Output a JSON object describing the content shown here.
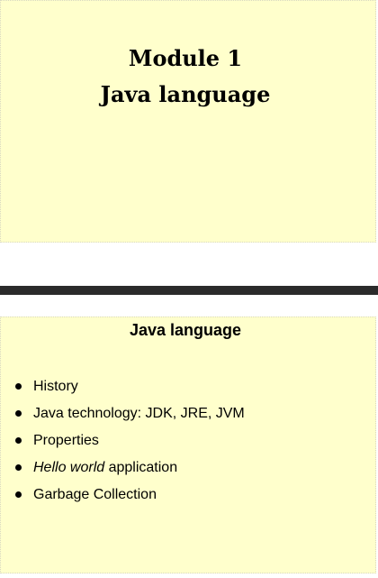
{
  "slide1": {
    "title": "Module 1",
    "subtitle": "Java language"
  },
  "slide2": {
    "title": "Java language",
    "bullets": [
      {
        "text": "History"
      },
      {
        "text": "Java technology: JDK, JRE, JVM"
      },
      {
        "text": "Properties"
      },
      {
        "italic": "Hello world",
        "text": " application"
      },
      {
        "text": "Garbage Collection"
      }
    ]
  }
}
